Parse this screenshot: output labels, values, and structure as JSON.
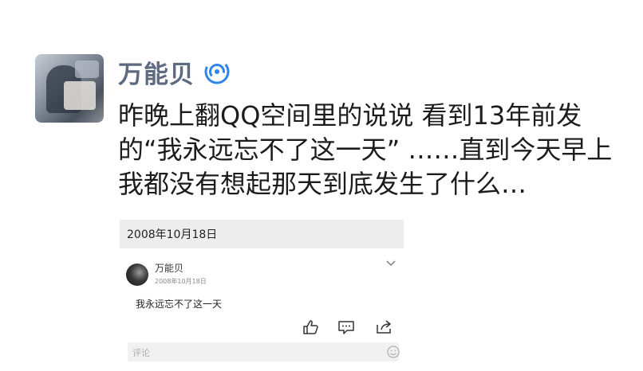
{
  "post": {
    "username": "万能贝",
    "text": "昨晚上翻QQ空间里的说说 看到13年前发的“我永远忘不了这一天” ……直到今天早上我都没有想起那天到底发生了什么…"
  },
  "embedded": {
    "header_date": "2008年10月18日",
    "author": "万能贝",
    "date": "2008年10月18日",
    "text": "我永远忘不了这一天",
    "comment_placeholder": "评论"
  },
  "icons": {
    "verified_badge": "swirl-badge-icon",
    "actions": [
      "thumbs-up-icon",
      "comment-icon",
      "share-icon"
    ],
    "chevron": "chevron-down-icon",
    "emoji": "emoji-icon"
  },
  "colors": {
    "username": "#5d6a80",
    "badge": "#2f86e8",
    "card_header_bg": "#ededed"
  }
}
